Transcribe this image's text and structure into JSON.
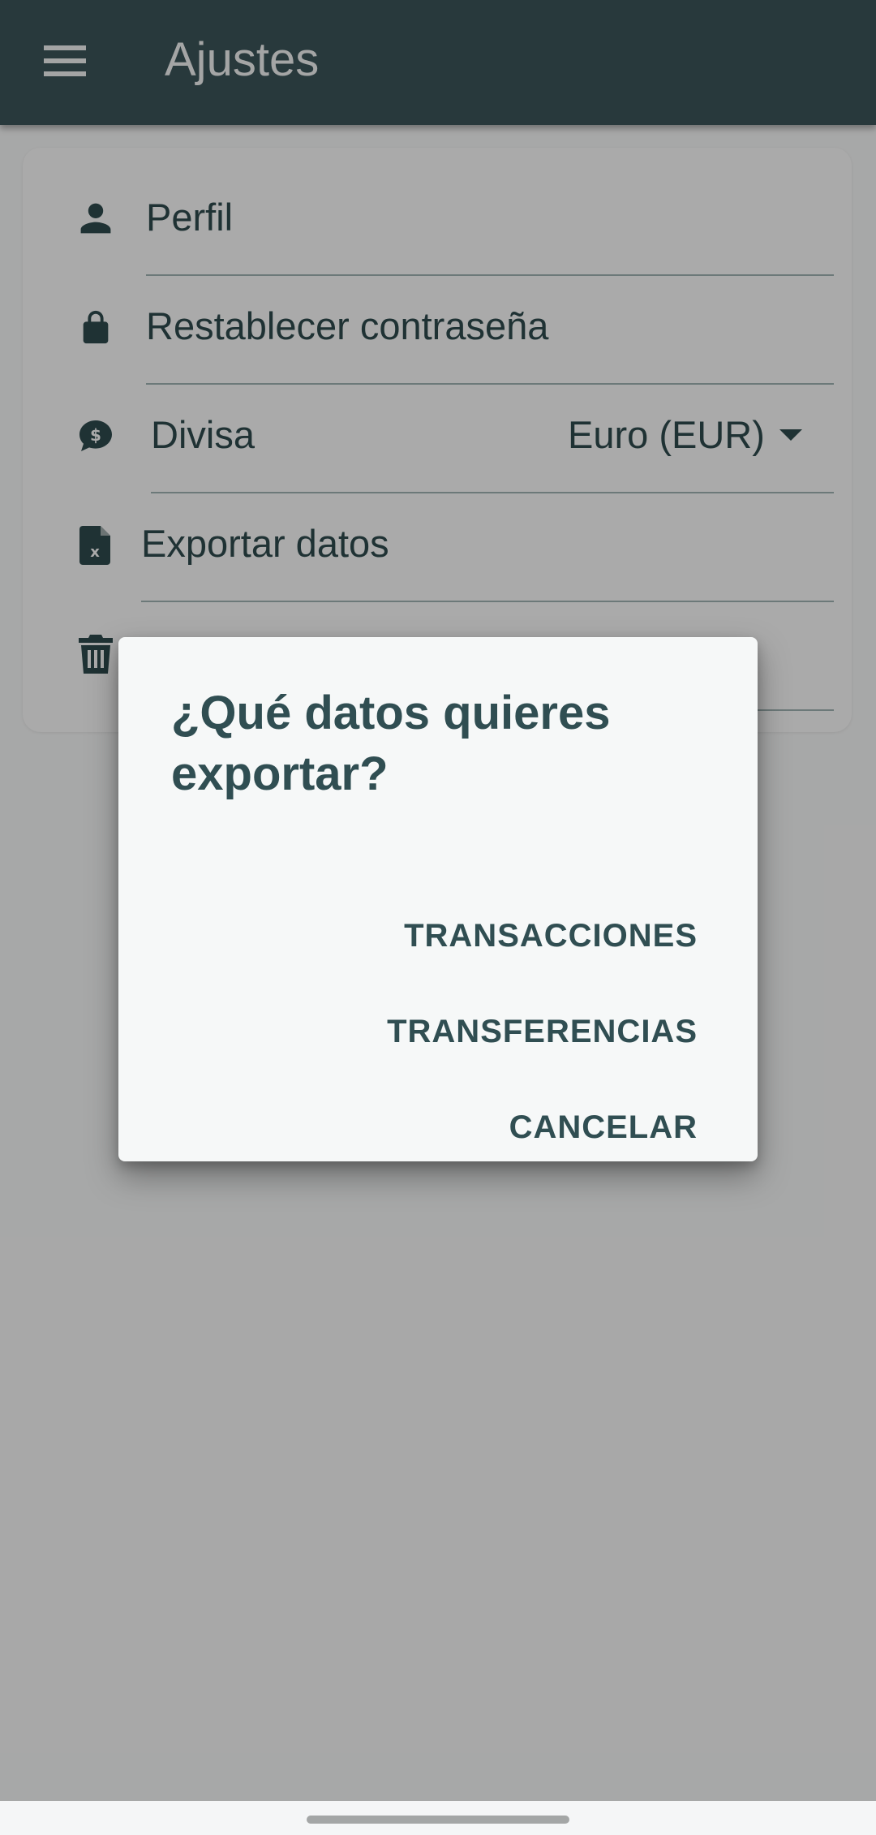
{
  "app_bar": {
    "title": "Ajustes",
    "menu_icon": "hamburger-menu-icon"
  },
  "settings": {
    "items": [
      {
        "label": "Perfil",
        "icon": "person-icon"
      },
      {
        "label": "Restablecer contraseña",
        "icon": "lock-icon"
      },
      {
        "label": "Divisa",
        "icon": "currency-chat-icon",
        "value": "Euro (EUR)"
      },
      {
        "label": "Exportar datos",
        "icon": "excel-file-icon"
      },
      {
        "label": "",
        "icon": "trash-icon"
      }
    ]
  },
  "dialog": {
    "title": "¿Qué datos quieres exportar?",
    "actions": [
      {
        "label": "TRANSACCIONES"
      },
      {
        "label": "TRANSFERENCIAS"
      },
      {
        "label": "CANCELAR"
      }
    ]
  },
  "colors": {
    "app_bar": "#3b5459",
    "text_primary": "#2f4a4d",
    "divider": "#9fb3b3",
    "scrim": "rgba(0,0,0,0.32)"
  }
}
